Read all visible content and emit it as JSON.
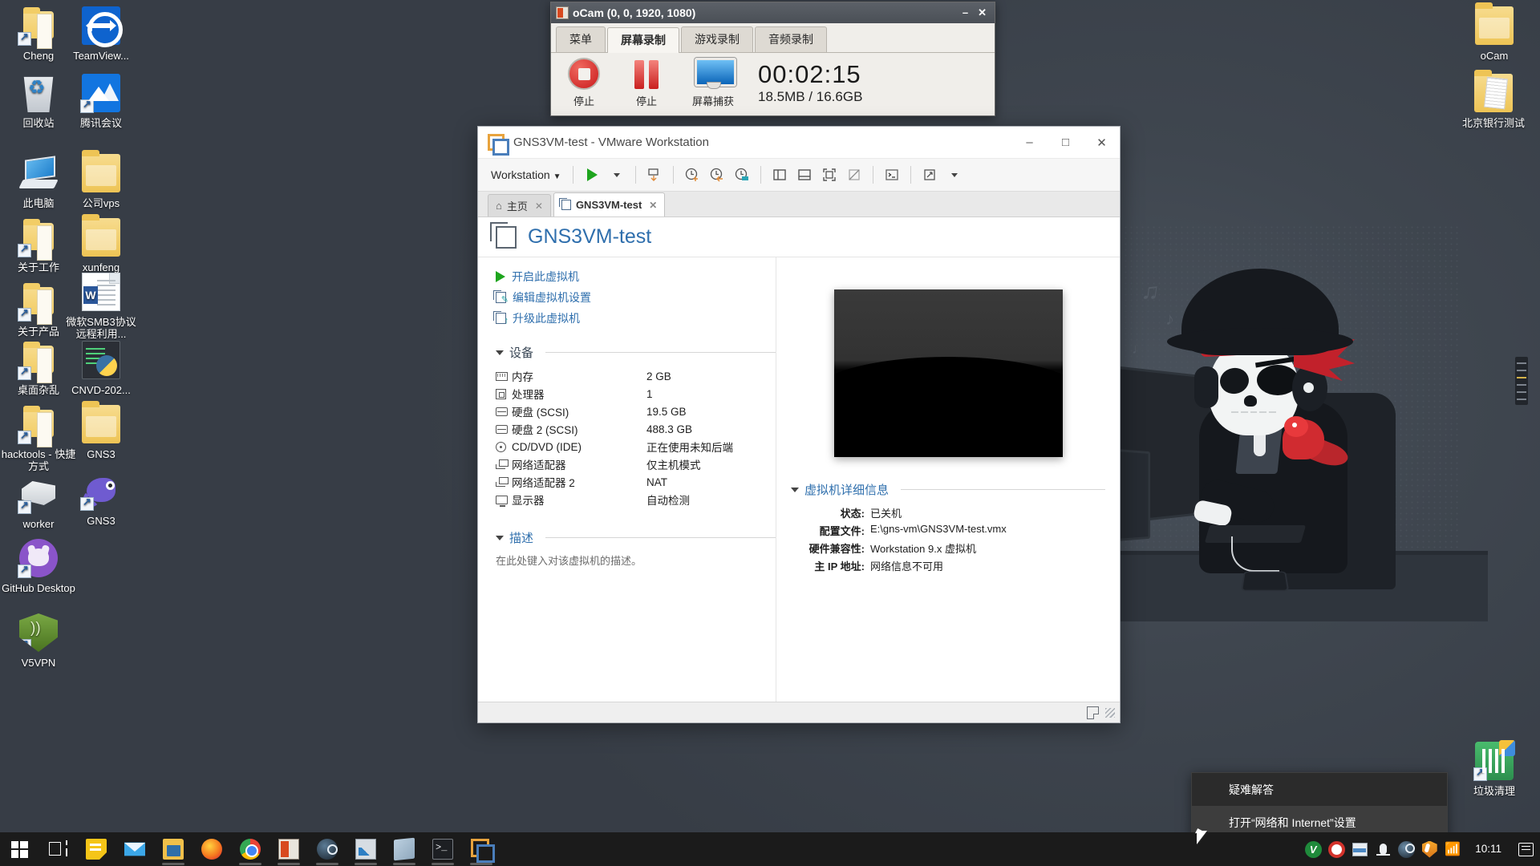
{
  "desktop": {
    "icons_left": [
      {
        "label": "Cheng",
        "icon": "folder-shortcut-icon",
        "col": 0,
        "row": 0
      },
      {
        "label": "TeamView...",
        "icon": "teamviewer-icon",
        "col": 1,
        "row": 0
      },
      {
        "label": "回收站",
        "icon": "recycle-bin-icon",
        "col": 0,
        "row": 1
      },
      {
        "label": "腾讯会议",
        "icon": "tencent-meeting-icon",
        "col": 1,
        "row": 1
      },
      {
        "label": "此电脑",
        "icon": "this-pc-icon",
        "col": 0,
        "row": 2
      },
      {
        "label": "公司vps",
        "icon": "folder-icon",
        "col": 1,
        "row": 2
      },
      {
        "label": "关于工作",
        "icon": "folder-shortcut-icon",
        "col": 0,
        "row": 3
      },
      {
        "label": "xunfeng",
        "icon": "folder-icon",
        "col": 1,
        "row": 3
      },
      {
        "label": "关于产品",
        "icon": "folder-shortcut-icon",
        "col": 0,
        "row": 4
      },
      {
        "label": "微软SMB3协议远程利用...",
        "icon": "word-document-icon",
        "col": 1,
        "row": 4
      },
      {
        "label": "桌面杂乱",
        "icon": "folder-shortcut-icon",
        "col": 0,
        "row": 5
      },
      {
        "label": "CNVD-202...",
        "icon": "python-script-icon",
        "col": 1,
        "row": 5
      },
      {
        "label": "hacktools - 快捷方式",
        "icon": "folder-shortcut-icon",
        "col": 0,
        "row": 6
      },
      {
        "label": "GNS3",
        "icon": "folder-icon",
        "col": 1,
        "row": 6
      },
      {
        "label": "worker",
        "icon": "box-shortcut-icon",
        "col": 0,
        "row": 7
      },
      {
        "label": "GNS3",
        "icon": "gns3-chameleon-icon",
        "col": 1,
        "row": 7
      },
      {
        "label": "GitHub Desktop",
        "icon": "github-desktop-icon",
        "col": 0,
        "row": 8
      },
      {
        "label": "V5VPN",
        "icon": "shield-vpn-icon",
        "col": 0,
        "row": 9
      }
    ],
    "icons_right": [
      {
        "label": "oCam",
        "icon": "folder-icon"
      },
      {
        "label": "北京银行测试",
        "icon": "folder-docs-icon"
      },
      {
        "label": "垃圾清理",
        "icon": "cleaner-shortcut-icon"
      }
    ]
  },
  "ocam": {
    "title": "oCam (0, 0, 1920, 1080)",
    "window_buttons": {
      "minimize": "–",
      "close": "✕"
    },
    "tabs": [
      {
        "label": "菜单",
        "active": false
      },
      {
        "label": "屏幕录制",
        "active": true
      },
      {
        "label": "游戏录制",
        "active": false
      },
      {
        "label": "音频录制",
        "active": false
      }
    ],
    "buttons": [
      {
        "label": "停止",
        "icon": "stop-record-icon"
      },
      {
        "label": "停止",
        "icon": "pause-record-icon"
      },
      {
        "label": "屏幕捕获",
        "icon": "screen-capture-icon"
      }
    ],
    "timer": "00:02:15",
    "size_info": "18.5MB / 16.6GB"
  },
  "vmware": {
    "title": "GNS3VM-test - VMware Workstation",
    "window_buttons": {
      "minimize": "–",
      "maximize": "□",
      "close": "✕"
    },
    "toolbar": {
      "menu_label": "Workstation",
      "buttons": [
        {
          "name": "power-on-button",
          "icon": "play-icon"
        },
        {
          "name": "power-dropdown",
          "icon": "caret-down-icon"
        },
        {
          "name": "manage-snapshot-button",
          "icon": "snapshot-manage-icon"
        },
        {
          "name": "take-snapshot-button",
          "icon": "snapshot-take-icon"
        },
        {
          "name": "revert-snapshot-button",
          "icon": "snapshot-revert-icon"
        },
        {
          "name": "snapshot-manager-button",
          "icon": "snapshot-manager-icon"
        },
        {
          "name": "show-library-button",
          "icon": "panel-left-icon"
        },
        {
          "name": "show-thumbnail-bar-button",
          "icon": "panel-bottom-icon"
        },
        {
          "name": "full-screen-button",
          "icon": "fullscreen-icon"
        },
        {
          "name": "unity-mode-button",
          "icon": "unity-disabled-icon"
        },
        {
          "name": "console-button",
          "icon": "terminal-icon"
        },
        {
          "name": "stretch-button",
          "icon": "stretch-icon"
        },
        {
          "name": "stretch-dropdown",
          "icon": "caret-down-icon"
        }
      ]
    },
    "tabs": [
      {
        "label": "主页",
        "icon": "home-icon",
        "active": false,
        "close": "✕"
      },
      {
        "label": "GNS3VM-test",
        "icon": "vm-doc-icon",
        "active": true,
        "close": "✕"
      }
    ],
    "vm_name": "GNS3VM-test",
    "actions": [
      {
        "label": "开启此虚拟机",
        "icon": "play-icon"
      },
      {
        "label": "编辑虚拟机设置",
        "icon": "edit-settings-icon"
      },
      {
        "label": "升级此虚拟机",
        "icon": "upgrade-vm-icon"
      }
    ],
    "devices_section_title": "设备",
    "devices": [
      {
        "icon": "memory-icon",
        "name": "内存",
        "value": "2 GB"
      },
      {
        "icon": "processor-icon",
        "name": "处理器",
        "value": "1"
      },
      {
        "icon": "harddisk-icon",
        "name": "硬盘 (SCSI)",
        "value": "19.5 GB"
      },
      {
        "icon": "harddisk-icon",
        "name": "硬盘 2 (SCSI)",
        "value": "488.3 GB"
      },
      {
        "icon": "cddvd-icon",
        "name": "CD/DVD (IDE)",
        "value": "正在使用未知后端"
      },
      {
        "icon": "network-icon",
        "name": "网络适配器",
        "value": "仅主机模式"
      },
      {
        "icon": "network-icon",
        "name": "网络适配器 2",
        "value": "NAT"
      },
      {
        "icon": "display-icon",
        "name": "显示器",
        "value": "自动检测"
      }
    ],
    "description_section_title": "描述",
    "description_placeholder": "在此处键入对该虚拟机的描述。",
    "details_section_title": "虚拟机详细信息",
    "details": [
      {
        "key": "状态:",
        "value": "已关机"
      },
      {
        "key": "配置文件:",
        "value": "E:\\gns-vm\\GNS3VM-test.vmx"
      },
      {
        "key": "硬件兼容性:",
        "value": "Workstation 9.x 虚拟机"
      },
      {
        "key": "主 IP 地址:",
        "value": "网络信息不可用"
      }
    ],
    "statusbar": {
      "note_icon": "note-icon",
      "grip_icon": "resize-grip-icon"
    }
  },
  "context_menu": {
    "items": [
      {
        "label": "疑难解答",
        "highlighted": false
      },
      {
        "label": "打开“网络和 Internet”设置",
        "highlighted": true
      }
    ]
  },
  "taskbar": {
    "start": {
      "icon": "windows-start-icon"
    },
    "items": [
      {
        "name": "task-view",
        "icon": "task-view-icon",
        "running": false
      },
      {
        "name": "sticky-notes",
        "icon": "sticky-notes-icon",
        "running": false
      },
      {
        "name": "mail",
        "icon": "mail-icon",
        "running": false
      },
      {
        "name": "file-explorer",
        "icon": "file-explorer-icon",
        "running": true
      },
      {
        "name": "firefox",
        "icon": "firefox-icon",
        "running": false
      },
      {
        "name": "chrome",
        "icon": "chrome-icon",
        "running": true
      },
      {
        "name": "ocam",
        "icon": "ocam-icon",
        "running": true
      },
      {
        "name": "steam",
        "icon": "steam-icon",
        "running": true
      },
      {
        "name": "chart-app",
        "icon": "chart-app-icon",
        "running": true
      },
      {
        "name": "notes-app",
        "icon": "notes-app-icon",
        "running": true
      },
      {
        "name": "terminal",
        "icon": "terminal-icon",
        "running": true
      },
      {
        "name": "vmware-workstation",
        "icon": "vmware-icon",
        "running": true
      }
    ],
    "tray": [
      {
        "name": "v-tray",
        "icon": "v-green-icon"
      },
      {
        "name": "recorder-tray",
        "icon": "record-ring-icon"
      },
      {
        "name": "grid-tray",
        "icon": "grid-blue-icon"
      },
      {
        "name": "microphone-tray",
        "icon": "microphone-icon"
      },
      {
        "name": "steam-tray",
        "icon": "steam-icon"
      },
      {
        "name": "security-tray",
        "icon": "shield-orange-icon"
      },
      {
        "name": "network-tray",
        "icon": "wifi-icon"
      }
    ],
    "clock": {
      "time": "10:11"
    },
    "action_center": {
      "icon": "action-center-icon"
    }
  }
}
